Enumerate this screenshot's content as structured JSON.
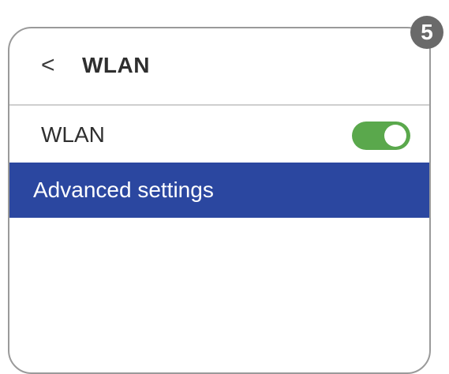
{
  "header": {
    "back_icon": "‹",
    "title": "WLAN"
  },
  "wlan_row": {
    "label": "WLAN",
    "toggle_on": true
  },
  "advanced_row": {
    "label": "Advanced settings"
  },
  "step_badge": {
    "number": "5"
  },
  "colors": {
    "toggle_on": "#5aa84c",
    "highlight": "#2b47a0",
    "badge": "#6a6a6a"
  }
}
